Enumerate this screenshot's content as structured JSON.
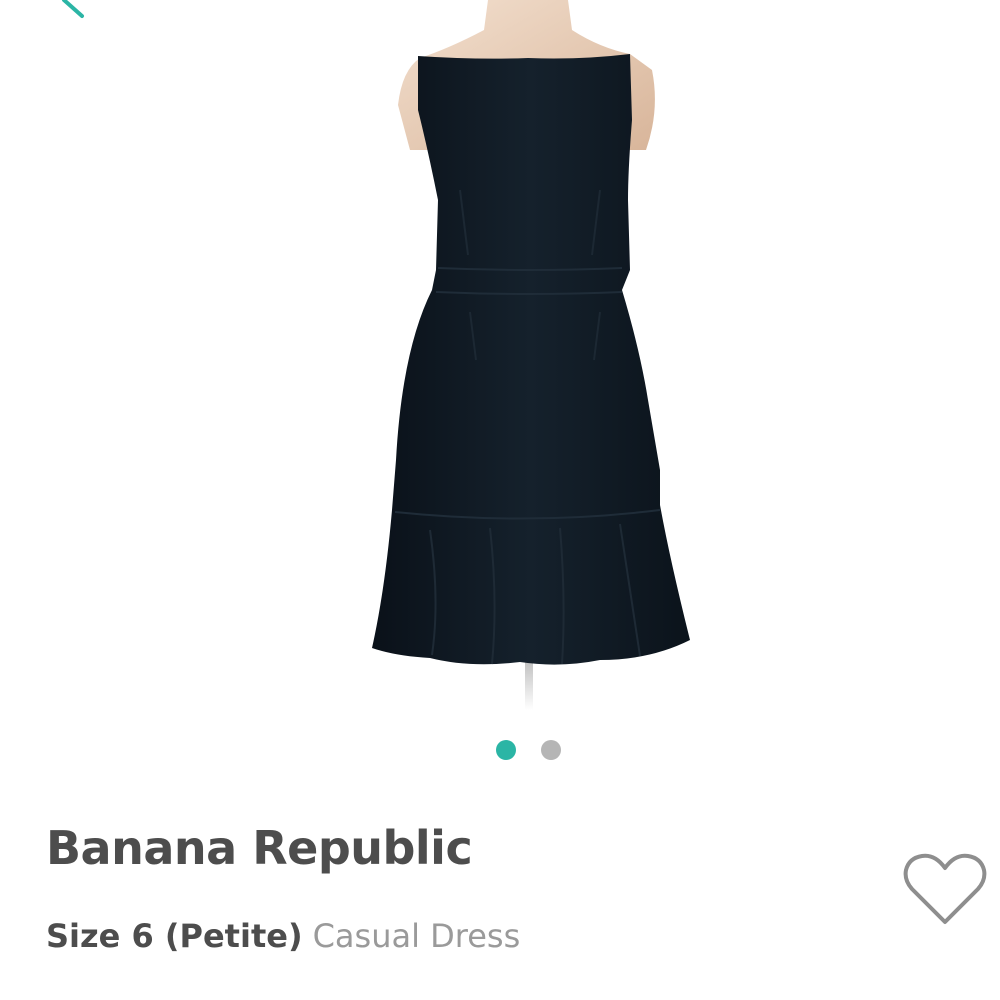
{
  "product": {
    "brand": "Banana Republic",
    "size": "Size 6 (Petite)",
    "category": "Casual Dress"
  },
  "carousel": {
    "active_index": 0,
    "total": 2
  },
  "colors": {
    "accent": "#2bb5a5",
    "inactive_dot": "#b5b5b5",
    "dress": "#111b24",
    "heart_outline": "#8e8e8e"
  },
  "icons": {
    "back": "chevron-left-icon",
    "favorite": "heart-outline-icon"
  }
}
